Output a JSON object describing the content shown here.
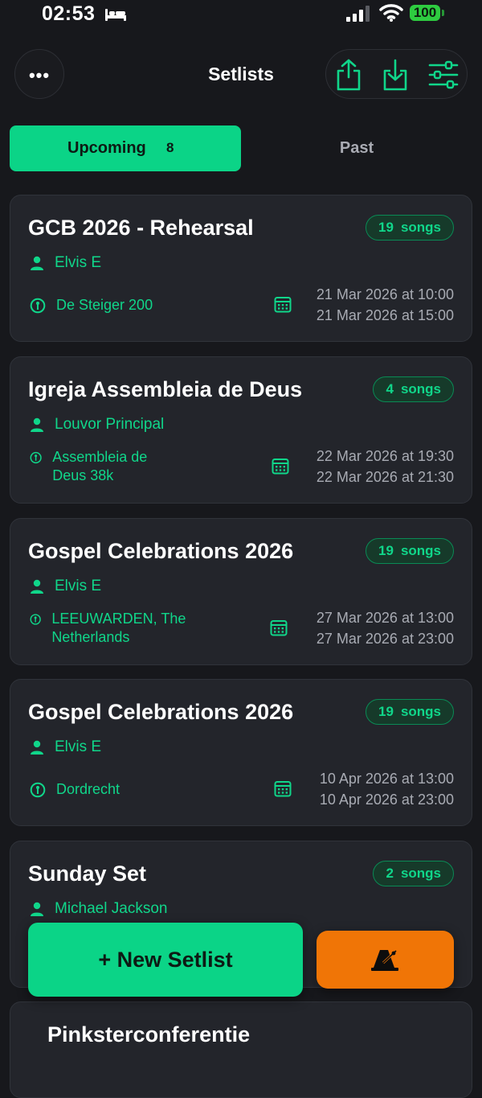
{
  "status_bar": {
    "time": "02:53",
    "battery": "100",
    "icons": [
      "bed-icon",
      "signal-icon",
      "wifi-icon",
      "battery-icon"
    ]
  },
  "header": {
    "title": "Setlists",
    "more_icon": "ellipsis-icon",
    "more_glyph": "•••",
    "actions": [
      "share-icon",
      "download-icon",
      "filter-sliders-icon"
    ]
  },
  "tabs": {
    "upcoming": {
      "label": "Upcoming",
      "count": "8"
    },
    "past": {
      "label": "Past"
    }
  },
  "colors": {
    "accent": "#0bd487",
    "background": "#17181c",
    "card": "#23252b",
    "metronome": "#f07506"
  },
  "setlists": [
    {
      "title": "GCB 2026 - Rehearsal",
      "song_count": "19",
      "songs_label": "songs",
      "person": "Elvis E",
      "location": "De Steiger 200",
      "start": "21 Mar 2026 at 10:00",
      "end": "21 Mar 2026 at 15:00"
    },
    {
      "title": "Igreja Assembleia de Deus",
      "song_count": "4",
      "songs_label": "songs",
      "person": "Louvor Principal",
      "location": "Assembleia de Deus 38k",
      "start": "22 Mar 2026 at 19:30",
      "end": "22 Mar 2026 at 21:30"
    },
    {
      "title": "Gospel Celebrations 2026",
      "song_count": "19",
      "songs_label": "songs",
      "person": "Elvis E",
      "location": "LEEUWARDEN, The Netherlands",
      "start": "27 Mar 2026 at 13:00",
      "end": "27 Mar 2026 at 23:00"
    },
    {
      "title": "Gospel Celebrations 2026",
      "song_count": "19",
      "songs_label": "songs",
      "person": "Elvis E",
      "location": "Dordrecht",
      "start": "10 Apr 2026 at 13:00",
      "end": "10 Apr 2026 at 23:00"
    },
    {
      "title": "Sunday Set",
      "song_count": "2",
      "songs_label": "songs",
      "person": "Michael Jackson"
    },
    {
      "title": "Pinksterconferentie"
    }
  ],
  "fab": {
    "new_setlist_label": "+ New Setlist",
    "metronome_icon": "metronome-icon"
  }
}
